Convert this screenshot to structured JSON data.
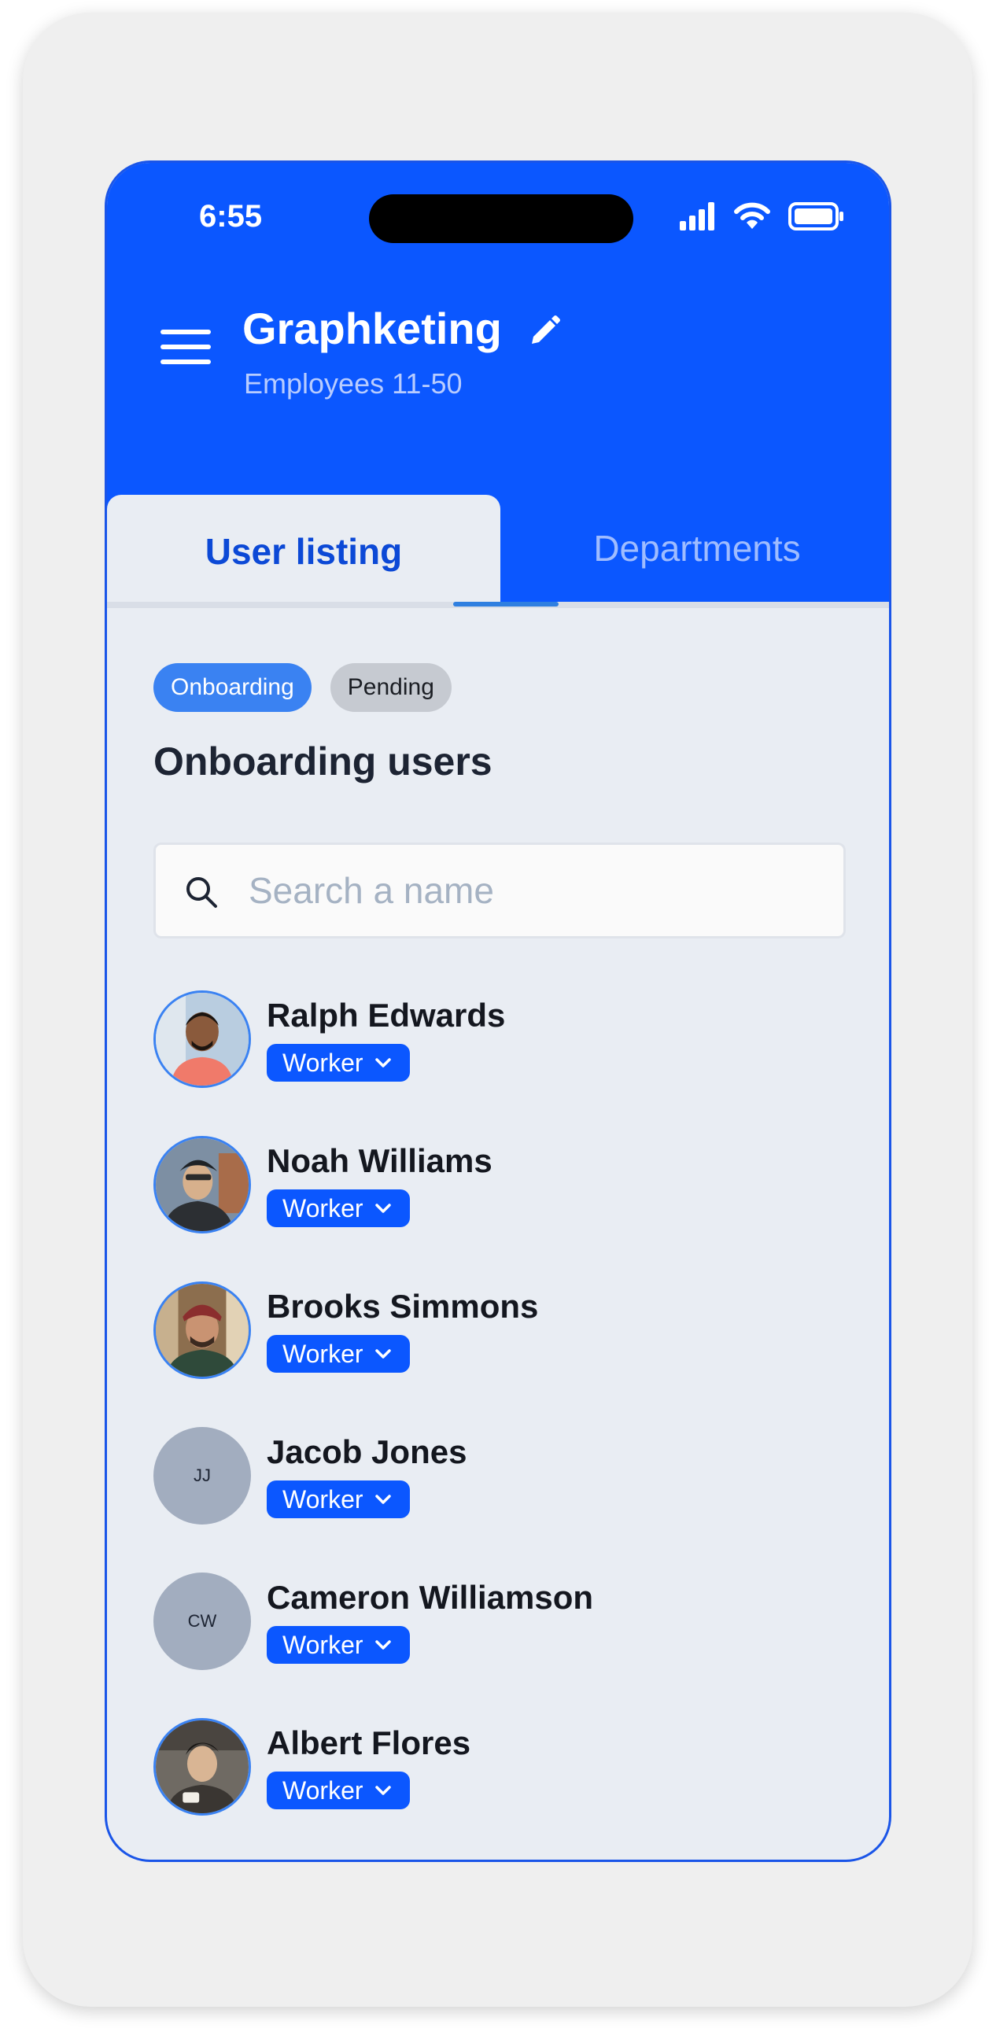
{
  "status_bar": {
    "time": "6:55"
  },
  "header": {
    "company_name": "Graphketing",
    "company_sub": "Employees 11-50"
  },
  "tabs": [
    {
      "label": "User listing",
      "active": true
    },
    {
      "label": "Departments",
      "active": false
    }
  ],
  "filters": [
    {
      "label": "Onboarding",
      "selected": true
    },
    {
      "label": "Pending",
      "selected": false
    }
  ],
  "section_title": "Onboarding users",
  "search": {
    "placeholder": "Search a name",
    "value": ""
  },
  "users": [
    {
      "name": "Ralph Edwards",
      "role": "Worker",
      "avatar": "photo",
      "initials": ""
    },
    {
      "name": "Noah Williams",
      "role": "Worker",
      "avatar": "photo",
      "initials": ""
    },
    {
      "name": "Brooks Simmons",
      "role": "Worker",
      "avatar": "photo",
      "initials": ""
    },
    {
      "name": "Jacob Jones",
      "role": "Worker",
      "avatar": "initials",
      "initials": "JJ"
    },
    {
      "name": "Cameron Williamson",
      "role": "Worker",
      "avatar": "initials",
      "initials": "CW"
    },
    {
      "name": "Albert Flores",
      "role": "Worker",
      "avatar": "photo",
      "initials": ""
    }
  ],
  "colors": {
    "primary": "#0b57ff",
    "tab_active_text": "#0c49d6",
    "chip_onboarding": "#3a82f2",
    "chip_pending": "#c6cad1",
    "content_bg": "#e9edf3"
  }
}
